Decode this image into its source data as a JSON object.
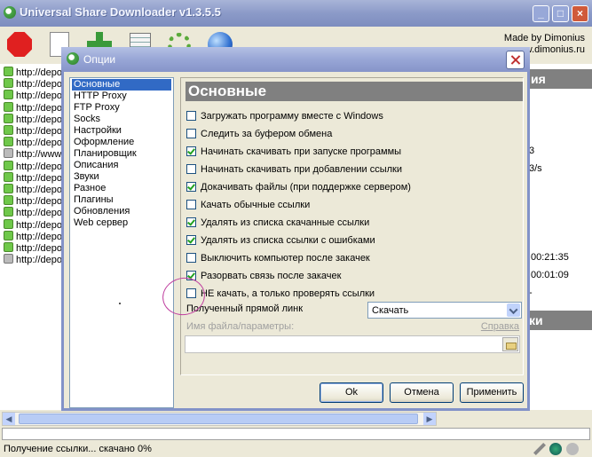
{
  "window": {
    "title": "Universal Share Downloader v1.3.5.5"
  },
  "madeby": {
    "line1": "Made by Dimonius",
    "line2": "www.dimonius.ru"
  },
  "links": [
    {
      "text": "http://depo",
      "state": "green"
    },
    {
      "text": "http://depo",
      "state": "green"
    },
    {
      "text": "http://depo",
      "state": "green"
    },
    {
      "text": "http://depo",
      "state": "green"
    },
    {
      "text": "http://depo",
      "state": "green"
    },
    {
      "text": "http://depo",
      "state": "green"
    },
    {
      "text": "http://depo",
      "state": "green"
    },
    {
      "text": "http://www",
      "state": "grey"
    },
    {
      "text": "http://depo",
      "state": "green"
    },
    {
      "text": "http://depo",
      "state": "green"
    },
    {
      "text": "http://depo",
      "state": "green"
    },
    {
      "text": "http://depo",
      "state": "green"
    },
    {
      "text": "http://depo",
      "state": "green"
    },
    {
      "text": "http://depo",
      "state": "green"
    },
    {
      "text": "http://depo",
      "state": "green"
    },
    {
      "text": "http://depo",
      "state": "green"
    },
    {
      "text": "http://depo",
      "state": "grey"
    }
  ],
  "right_panel": {
    "header1": "ия",
    "val1": "3",
    "val2": "3/s",
    "time1": "00:21:35",
    "time2": "00:01:09",
    "val3": "-",
    "header2": "ки"
  },
  "dialog": {
    "title": "Опции",
    "nav": [
      "Основные",
      "HTTP Proxy",
      "FTP Proxy",
      "Socks",
      "Настройки",
      "Оформление",
      "Планировщик",
      "Описания",
      "Звуки",
      "Разное",
      "Плагины",
      "Обновления",
      "Web сервер"
    ],
    "nav_selected": 0,
    "pane_title": "Основные",
    "options": [
      {
        "label": "Загружать программу вместе с Windows",
        "checked": false
      },
      {
        "label": "Следить за буфером обмена",
        "checked": false
      },
      {
        "label": "Начинать скачивать при запуске программы",
        "checked": true
      },
      {
        "label": "Начинать скачивать при добавлении ссылки",
        "checked": false
      },
      {
        "label": "Докачивать файлы (при поддержке сервером)",
        "checked": true
      },
      {
        "label": "Качать обычные ссылки",
        "checked": false
      },
      {
        "label": "Удалять из списка скачанные ссылки",
        "checked": true
      },
      {
        "label": "Удалять из списка ссылки с ошибками",
        "checked": true
      },
      {
        "label": "Выключить компьютер после закачек",
        "checked": false
      },
      {
        "label": "Разорвать связь после закачек",
        "checked": true
      },
      {
        "label": "НЕ качать, а только проверять ссылки",
        "checked": false
      }
    ],
    "direct_link_label": "Полученный прямой линк",
    "direct_link_value": "Скачать",
    "filename_label": "Имя файла/параметры:",
    "help_link": "Справка",
    "filename_value": "",
    "ok": "Ok",
    "cancel": "Отмена",
    "apply": "Применить"
  },
  "status": {
    "text": "Получение ссылки... скачано 0%"
  }
}
